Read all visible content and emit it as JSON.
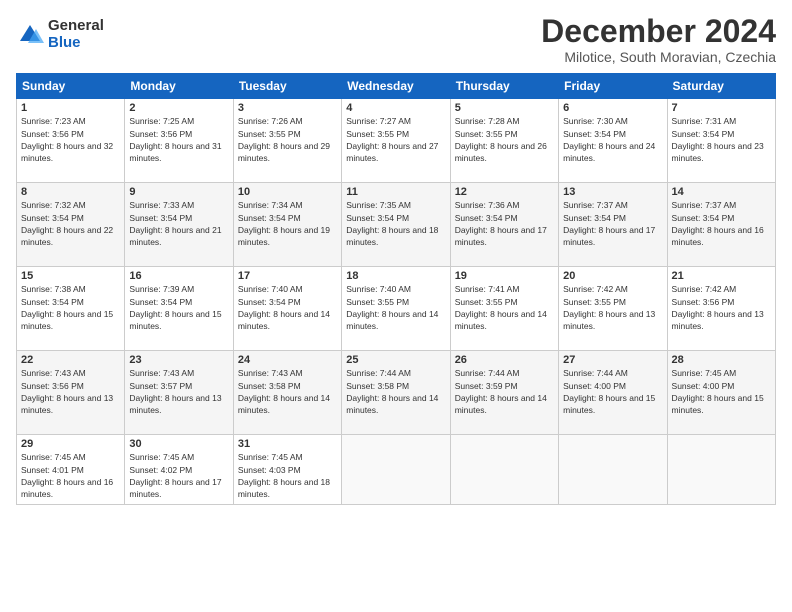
{
  "logo": {
    "general": "General",
    "blue": "Blue"
  },
  "title": "December 2024",
  "subtitle": "Milotice, South Moravian, Czechia",
  "weekdays": [
    "Sunday",
    "Monday",
    "Tuesday",
    "Wednesday",
    "Thursday",
    "Friday",
    "Saturday"
  ],
  "weeks": [
    [
      {
        "day": "1",
        "sunrise": "Sunrise: 7:23 AM",
        "sunset": "Sunset: 3:56 PM",
        "daylight": "Daylight: 8 hours and 32 minutes."
      },
      {
        "day": "2",
        "sunrise": "Sunrise: 7:25 AM",
        "sunset": "Sunset: 3:56 PM",
        "daylight": "Daylight: 8 hours and 31 minutes."
      },
      {
        "day": "3",
        "sunrise": "Sunrise: 7:26 AM",
        "sunset": "Sunset: 3:55 PM",
        "daylight": "Daylight: 8 hours and 29 minutes."
      },
      {
        "day": "4",
        "sunrise": "Sunrise: 7:27 AM",
        "sunset": "Sunset: 3:55 PM",
        "daylight": "Daylight: 8 hours and 27 minutes."
      },
      {
        "day": "5",
        "sunrise": "Sunrise: 7:28 AM",
        "sunset": "Sunset: 3:55 PM",
        "daylight": "Daylight: 8 hours and 26 minutes."
      },
      {
        "day": "6",
        "sunrise": "Sunrise: 7:30 AM",
        "sunset": "Sunset: 3:54 PM",
        "daylight": "Daylight: 8 hours and 24 minutes."
      },
      {
        "day": "7",
        "sunrise": "Sunrise: 7:31 AM",
        "sunset": "Sunset: 3:54 PM",
        "daylight": "Daylight: 8 hours and 23 minutes."
      }
    ],
    [
      {
        "day": "8",
        "sunrise": "Sunrise: 7:32 AM",
        "sunset": "Sunset: 3:54 PM",
        "daylight": "Daylight: 8 hours and 22 minutes."
      },
      {
        "day": "9",
        "sunrise": "Sunrise: 7:33 AM",
        "sunset": "Sunset: 3:54 PM",
        "daylight": "Daylight: 8 hours and 21 minutes."
      },
      {
        "day": "10",
        "sunrise": "Sunrise: 7:34 AM",
        "sunset": "Sunset: 3:54 PM",
        "daylight": "Daylight: 8 hours and 19 minutes."
      },
      {
        "day": "11",
        "sunrise": "Sunrise: 7:35 AM",
        "sunset": "Sunset: 3:54 PM",
        "daylight": "Daylight: 8 hours and 18 minutes."
      },
      {
        "day": "12",
        "sunrise": "Sunrise: 7:36 AM",
        "sunset": "Sunset: 3:54 PM",
        "daylight": "Daylight: 8 hours and 17 minutes."
      },
      {
        "day": "13",
        "sunrise": "Sunrise: 7:37 AM",
        "sunset": "Sunset: 3:54 PM",
        "daylight": "Daylight: 8 hours and 17 minutes."
      },
      {
        "day": "14",
        "sunrise": "Sunrise: 7:37 AM",
        "sunset": "Sunset: 3:54 PM",
        "daylight": "Daylight: 8 hours and 16 minutes."
      }
    ],
    [
      {
        "day": "15",
        "sunrise": "Sunrise: 7:38 AM",
        "sunset": "Sunset: 3:54 PM",
        "daylight": "Daylight: 8 hours and 15 minutes."
      },
      {
        "day": "16",
        "sunrise": "Sunrise: 7:39 AM",
        "sunset": "Sunset: 3:54 PM",
        "daylight": "Daylight: 8 hours and 15 minutes."
      },
      {
        "day": "17",
        "sunrise": "Sunrise: 7:40 AM",
        "sunset": "Sunset: 3:54 PM",
        "daylight": "Daylight: 8 hours and 14 minutes."
      },
      {
        "day": "18",
        "sunrise": "Sunrise: 7:40 AM",
        "sunset": "Sunset: 3:55 PM",
        "daylight": "Daylight: 8 hours and 14 minutes."
      },
      {
        "day": "19",
        "sunrise": "Sunrise: 7:41 AM",
        "sunset": "Sunset: 3:55 PM",
        "daylight": "Daylight: 8 hours and 14 minutes."
      },
      {
        "day": "20",
        "sunrise": "Sunrise: 7:42 AM",
        "sunset": "Sunset: 3:55 PM",
        "daylight": "Daylight: 8 hours and 13 minutes."
      },
      {
        "day": "21",
        "sunrise": "Sunrise: 7:42 AM",
        "sunset": "Sunset: 3:56 PM",
        "daylight": "Daylight: 8 hours and 13 minutes."
      }
    ],
    [
      {
        "day": "22",
        "sunrise": "Sunrise: 7:43 AM",
        "sunset": "Sunset: 3:56 PM",
        "daylight": "Daylight: 8 hours and 13 minutes."
      },
      {
        "day": "23",
        "sunrise": "Sunrise: 7:43 AM",
        "sunset": "Sunset: 3:57 PM",
        "daylight": "Daylight: 8 hours and 13 minutes."
      },
      {
        "day": "24",
        "sunrise": "Sunrise: 7:43 AM",
        "sunset": "Sunset: 3:58 PM",
        "daylight": "Daylight: 8 hours and 14 minutes."
      },
      {
        "day": "25",
        "sunrise": "Sunrise: 7:44 AM",
        "sunset": "Sunset: 3:58 PM",
        "daylight": "Daylight: 8 hours and 14 minutes."
      },
      {
        "day": "26",
        "sunrise": "Sunrise: 7:44 AM",
        "sunset": "Sunset: 3:59 PM",
        "daylight": "Daylight: 8 hours and 14 minutes."
      },
      {
        "day": "27",
        "sunrise": "Sunrise: 7:44 AM",
        "sunset": "Sunset: 4:00 PM",
        "daylight": "Daylight: 8 hours and 15 minutes."
      },
      {
        "day": "28",
        "sunrise": "Sunrise: 7:45 AM",
        "sunset": "Sunset: 4:00 PM",
        "daylight": "Daylight: 8 hours and 15 minutes."
      }
    ],
    [
      {
        "day": "29",
        "sunrise": "Sunrise: 7:45 AM",
        "sunset": "Sunset: 4:01 PM",
        "daylight": "Daylight: 8 hours and 16 minutes."
      },
      {
        "day": "30",
        "sunrise": "Sunrise: 7:45 AM",
        "sunset": "Sunset: 4:02 PM",
        "daylight": "Daylight: 8 hours and 17 minutes."
      },
      {
        "day": "31",
        "sunrise": "Sunrise: 7:45 AM",
        "sunset": "Sunset: 4:03 PM",
        "daylight": "Daylight: 8 hours and 18 minutes."
      },
      null,
      null,
      null,
      null
    ]
  ]
}
